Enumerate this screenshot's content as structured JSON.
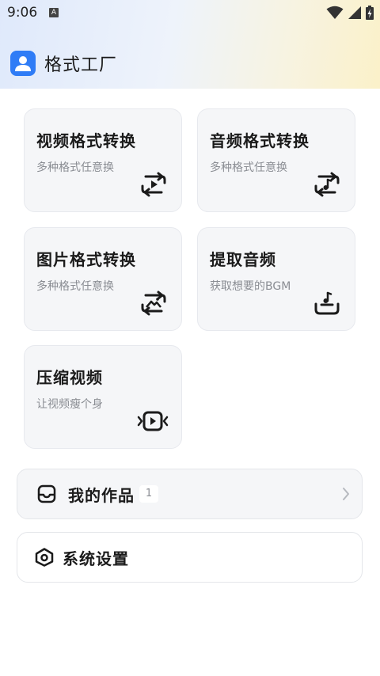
{
  "status_bar": {
    "time": "9:06",
    "notification_icon": "A"
  },
  "app": {
    "title": "格式工厂"
  },
  "cards": [
    {
      "title": "视频格式转换",
      "subtitle": "多种格式任意换",
      "icon": "video-convert-icon"
    },
    {
      "title": "音频格式转换",
      "subtitle": "多种格式任意换",
      "icon": "audio-convert-icon"
    },
    {
      "title": "图片格式转换",
      "subtitle": "多种格式任意换",
      "icon": "image-convert-icon"
    },
    {
      "title": "提取音频",
      "subtitle": "获取想要的BGM",
      "icon": "extract-audio-icon"
    },
    {
      "title": "压缩视频",
      "subtitle": "让视频瘦个身",
      "icon": "compress-video-icon"
    }
  ],
  "my_works": {
    "label": "我的作品",
    "count": "1"
  },
  "settings": {
    "label": "系统设置"
  },
  "colors": {
    "accent": "#2f7cf6",
    "card_bg": "#f5f6f8",
    "subtext": "#8a8d93"
  }
}
